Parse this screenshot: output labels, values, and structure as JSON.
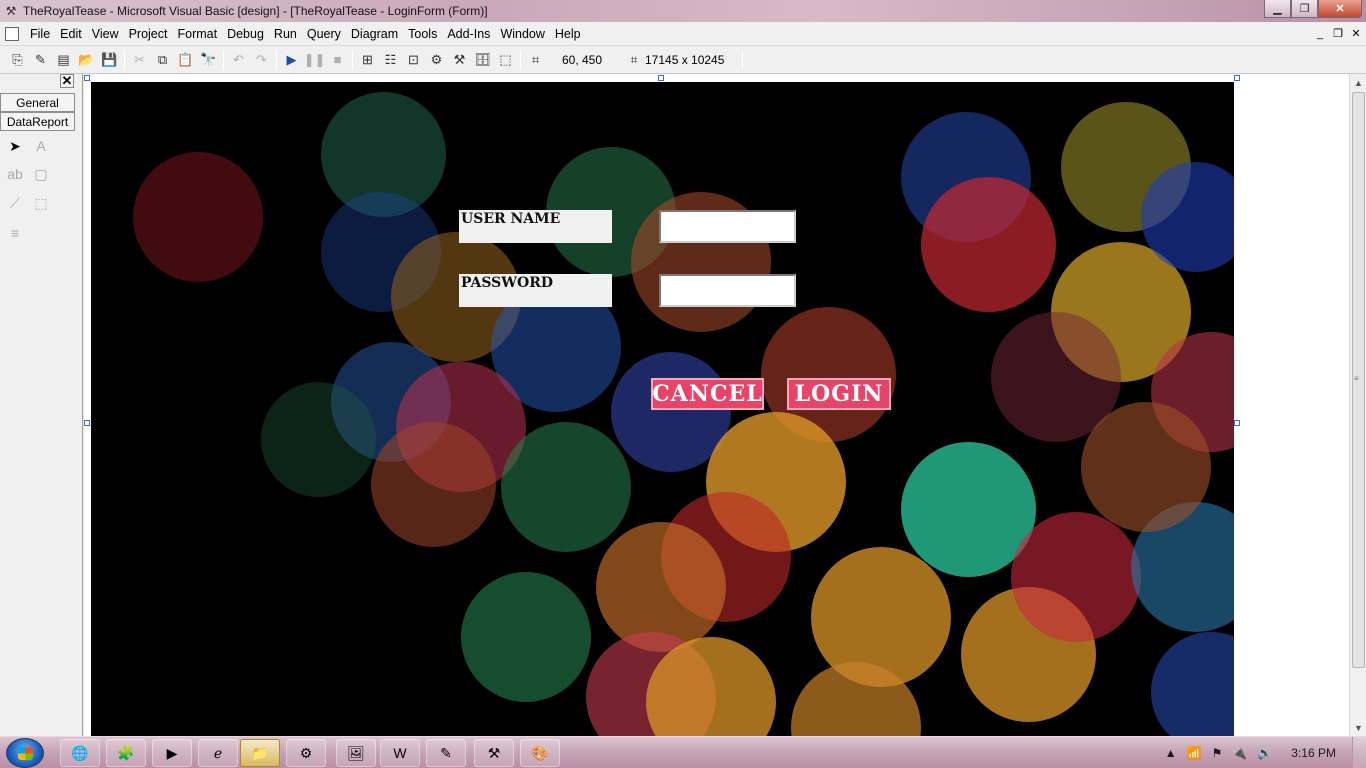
{
  "window": {
    "title": "TheRoyalTease - Microsoft Visual Basic [design] - [TheRoyalTease - LoginForm (Form)]"
  },
  "menu": [
    "File",
    "Edit",
    "View",
    "Project",
    "Format",
    "Debug",
    "Run",
    "Query",
    "Diagram",
    "Tools",
    "Add-Ins",
    "Window",
    "Help"
  ],
  "toolbar": {
    "position": "60, 450",
    "size": "17145 x 10245"
  },
  "toolbox": {
    "tabs": [
      "General",
      "DataReport"
    ]
  },
  "form": {
    "username_label": "USER NAME",
    "password_label": "PASSWORD",
    "cancel_label": "CANCEL",
    "login_label": "LOGIN"
  },
  "taskbar": {
    "clock": "3:16 PM"
  }
}
